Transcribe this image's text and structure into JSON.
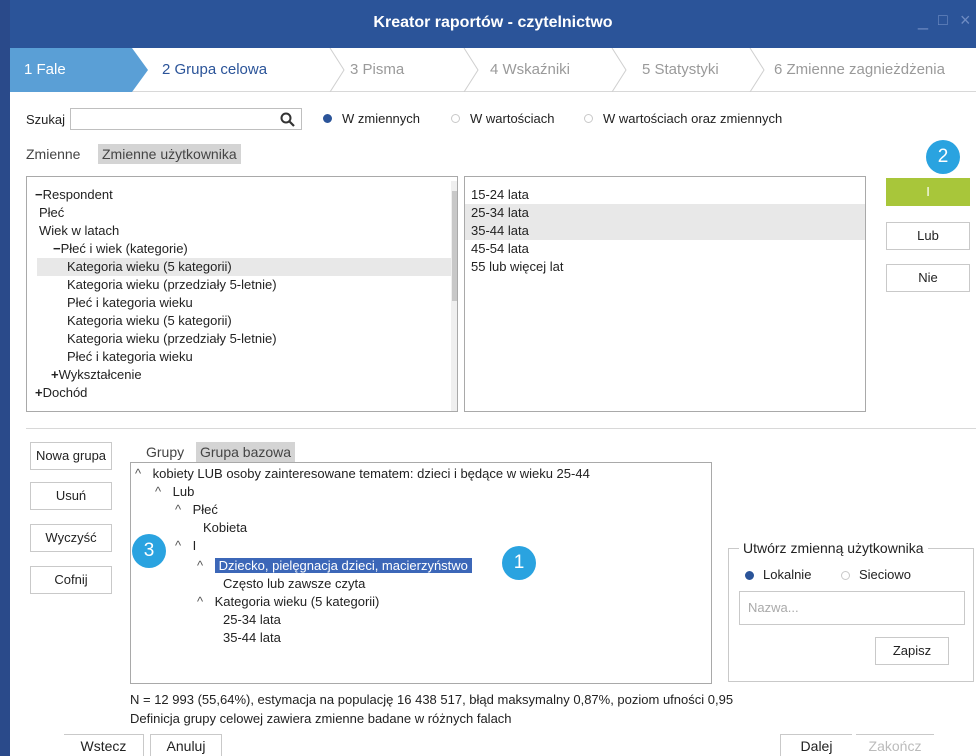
{
  "window": {
    "title": "Kreator raportów - czytelnictwo",
    "minimize": "_",
    "maximize": "□",
    "close": "×"
  },
  "steps": [
    "1 Fale",
    "2 Grupa celowa",
    "3 Pisma",
    "4 Wskaźniki",
    "5 Statystyki",
    "6 Zmienne zagnieżdżenia"
  ],
  "search": {
    "label": "Szukaj",
    "value": "",
    "options": [
      "W zmiennych",
      "W wartościach",
      "W wartościach oraz zmiennych"
    ],
    "selected": "W zmiennych"
  },
  "var_tabs": [
    "Zmienne",
    "Zmienne użytkownika"
  ],
  "variables": [
    {
      "prefix": "−",
      "label": "Respondent"
    },
    {
      "prefix": "",
      "label": "Płeć"
    },
    {
      "prefix": "",
      "label": "Wiek w latach"
    },
    {
      "prefix": "−",
      "label": "Płeć i wiek (kategorie)"
    },
    {
      "prefix": "",
      "label": "Kategoria wieku (5 kategorii)"
    },
    {
      "prefix": "",
      "label": "Kategoria wieku (przedziały 5-letnie)"
    },
    {
      "prefix": "",
      "label": "Płeć i kategoria wieku"
    },
    {
      "prefix": "",
      "label": "Kategoria wieku (5 kategorii)"
    },
    {
      "prefix": "",
      "label": "Kategoria wieku (przedziały 5-letnie)"
    },
    {
      "prefix": "",
      "label": "Płeć i kategoria wieku"
    },
    {
      "prefix": "+",
      "label": "Wykształcenie"
    },
    {
      "prefix": "+",
      "label": "Dochód"
    }
  ],
  "values": [
    "15-24 lata",
    "25-34 lata",
    "35-44 lata",
    "45-54 lata",
    "55 lub więcej lat"
  ],
  "logic_buttons": {
    "and": "I",
    "or": "Lub",
    "not": "Nie"
  },
  "group_buttons": {
    "new": "Nowa grupa",
    "remove": "Usuń",
    "clear": "Wyczyść",
    "undo": "Cofnij"
  },
  "group_tabs": [
    "Grupy",
    "Grupa bazowa"
  ],
  "group_tree": [
    {
      "caret": "^",
      "label": "kobiety LUB osoby zainteresowane tematem: dzieci i będące w wieku 25-44"
    },
    {
      "caret": "^",
      "label": "Lub"
    },
    {
      "caret": "^",
      "label": "Płeć"
    },
    {
      "caret": "",
      "label": "Kobieta"
    },
    {
      "caret": "^",
      "label": "I"
    },
    {
      "caret": "^",
      "label": "Dziecko, pielęgnacja dzieci, macierzyństwo"
    },
    {
      "caret": "",
      "label": "Często lub zawsze czyta"
    },
    {
      "caret": "^",
      "label": "Kategoria wieku (5 kategorii)"
    },
    {
      "caret": "",
      "label": "25-34 lata"
    },
    {
      "caret": "",
      "label": "35-44 lata"
    }
  ],
  "badges": [
    "2",
    "3",
    "1"
  ],
  "user_var": {
    "legend": "Utwórz zmienną użytkownika",
    "local": "Lokalnie",
    "network": "Sieciowo",
    "name_placeholder": "Nazwa...",
    "save": "Zapisz"
  },
  "status": {
    "line1": "N = 12 993 (55,64%), estymacja na populację 16 438 517, błąd maksymalny 0,87%, poziom ufności 0,95",
    "line2": "Definicja grupy celowej zawiera zmienne badane w różnych falach"
  },
  "footer": {
    "back": "Wstecz",
    "cancel": "Anuluj",
    "next": "Dalej",
    "finish": "Zakończ"
  },
  "colors": {
    "titlebar": "#2b5499",
    "active_step": "#5a9fd6",
    "green": "#a8c63a",
    "badge": "#2aa3e0",
    "highlight": "#3c67b8"
  }
}
